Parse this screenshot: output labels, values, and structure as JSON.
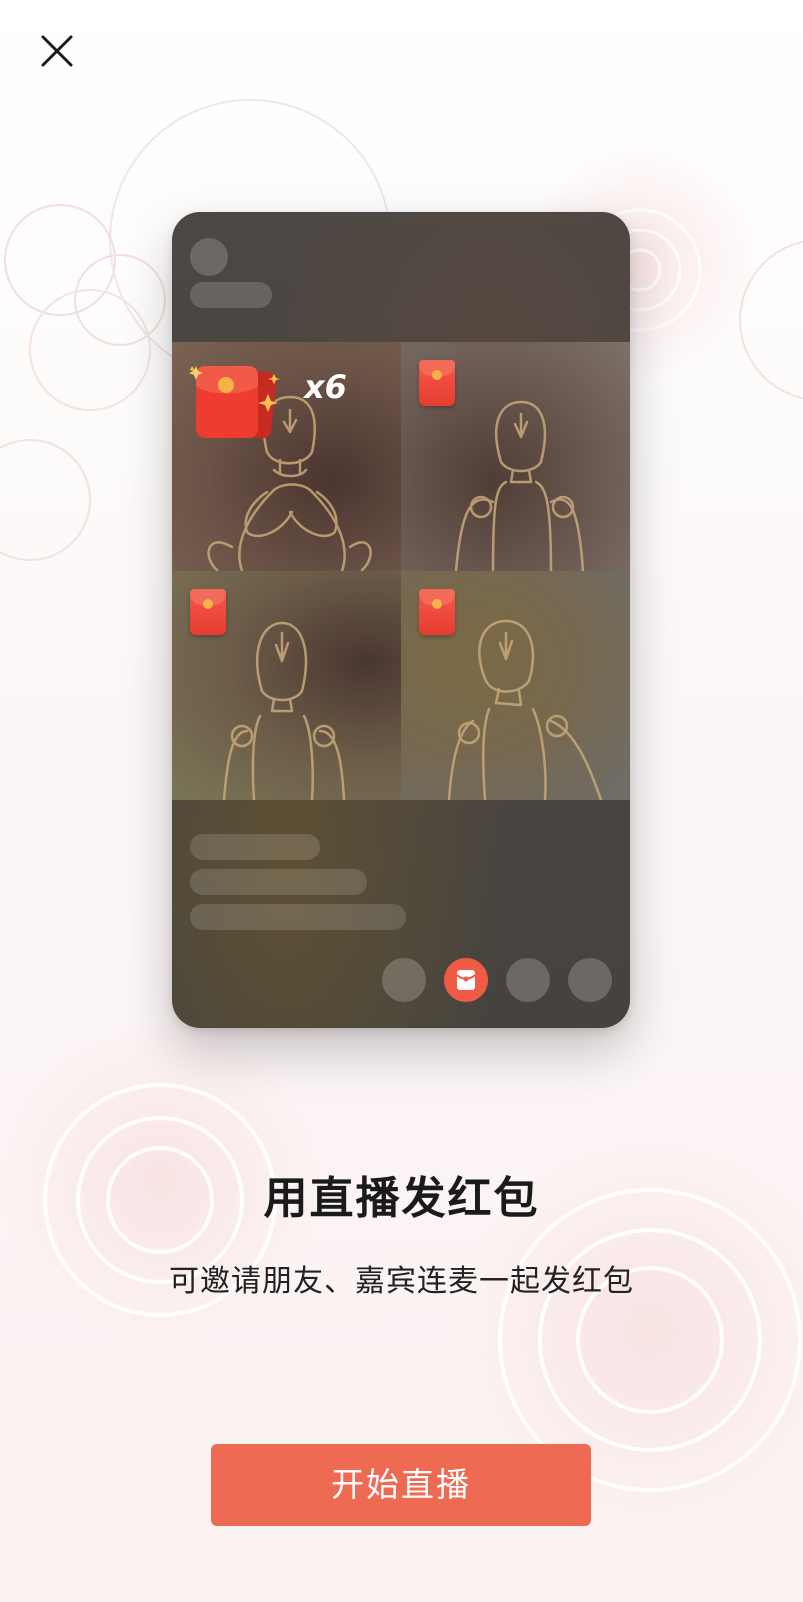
{
  "header": {
    "close_icon": "close-icon"
  },
  "preview": {
    "badge_count": "x6",
    "gift_icon": "red-envelope-icon",
    "controls": [
      "control-placeholder",
      "red-envelope-icon",
      "control-placeholder",
      "control-placeholder"
    ]
  },
  "main": {
    "title": "用直播发红包",
    "subtitle": "可邀请朋友、嘉宾连麦一起发红包"
  },
  "footer": {
    "start_label": "开始直播"
  },
  "colors": {
    "accent": "#ee6a52",
    "envelope": "#e63c30",
    "coin": "#f6b24a"
  }
}
